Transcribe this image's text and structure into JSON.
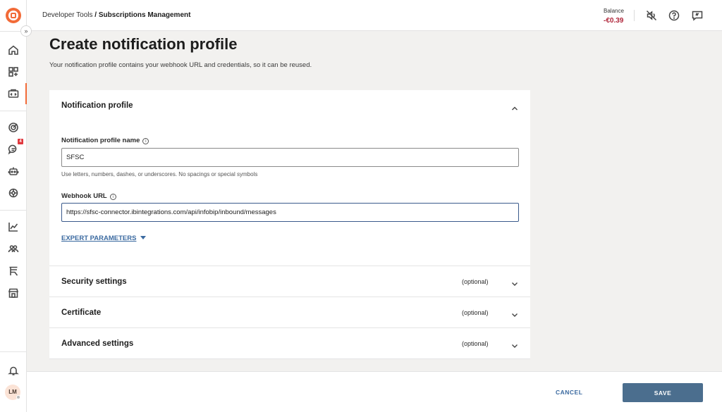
{
  "header": {
    "breadcrumb_parent": "Developer Tools",
    "breadcrumb_separator": " / ",
    "breadcrumb_current": "Subscriptions Management",
    "balance_label": "Balance",
    "balance_value": "-€0.39"
  },
  "sidebar": {
    "expand_icon": "»",
    "notification_badge": "4",
    "avatar_initials": "LM"
  },
  "page": {
    "title": "Create notification profile",
    "subtitle": "Your notification profile contains your webhook URL and credentials, so it can be reused."
  },
  "profile_panel": {
    "title": "Notification profile",
    "name_label": "Notification profile name",
    "name_value": "SFSC",
    "name_helper": "Use letters, numbers, dashes, or underscores. No spacings or special symbols",
    "webhook_label": "Webhook URL",
    "webhook_value": "https://sfsc-connector.ibintegrations.com/api/infobip/inbound/messages",
    "expert_link": "EXPERT PARAMETERS",
    "info_glyph": "i"
  },
  "sections": [
    {
      "title": "Security settings",
      "optional": "(optional)"
    },
    {
      "title": "Certificate",
      "optional": "(optional)"
    },
    {
      "title": "Advanced settings",
      "optional": "(optional)"
    }
  ],
  "footer": {
    "cancel_label": "CANCEL",
    "save_label": "SAVE"
  },
  "colors": {
    "accent": "#f26b38",
    "primary_button": "#4b6e8e",
    "link": "#3b6aa0",
    "balance_negative": "#b0263a"
  }
}
